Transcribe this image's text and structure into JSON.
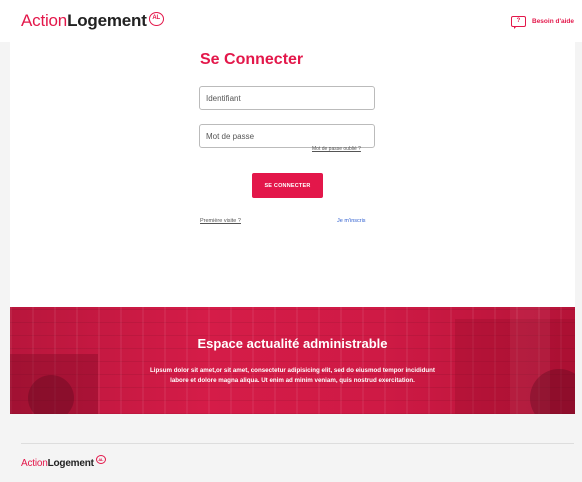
{
  "header": {
    "logo": {
      "part1": "Action",
      "part2": "Logement",
      "mark": "AL"
    },
    "help": {
      "label": "Besoin d'aide",
      "icon_text": "?"
    }
  },
  "login": {
    "title": "Se Connecter",
    "identifier_placeholder": "Identifiant",
    "password_placeholder": "Mot de passe",
    "forgot_password": "Mot de passe oublié ?",
    "submit": "SE CONNECTER",
    "first_visit": "Première visite ?",
    "register": "Je m'inscris"
  },
  "news": {
    "title": "Espace actualité administrable",
    "line1": "Lipsum dolor sit amet,or sit amet, consectetur adipisicing elit, sed do eiusmod tempor incididunt",
    "line2": "labore et dolore magna aliqua. Ut enim ad minim veniam, quis nostrud exercitation."
  },
  "footer": {
    "logo": {
      "part1": "Action",
      "part2": "Logement",
      "mark": "AL"
    }
  },
  "colors": {
    "accent": "#e3174a",
    "link": "#2f5fd0",
    "background": "#f4f4f4"
  }
}
